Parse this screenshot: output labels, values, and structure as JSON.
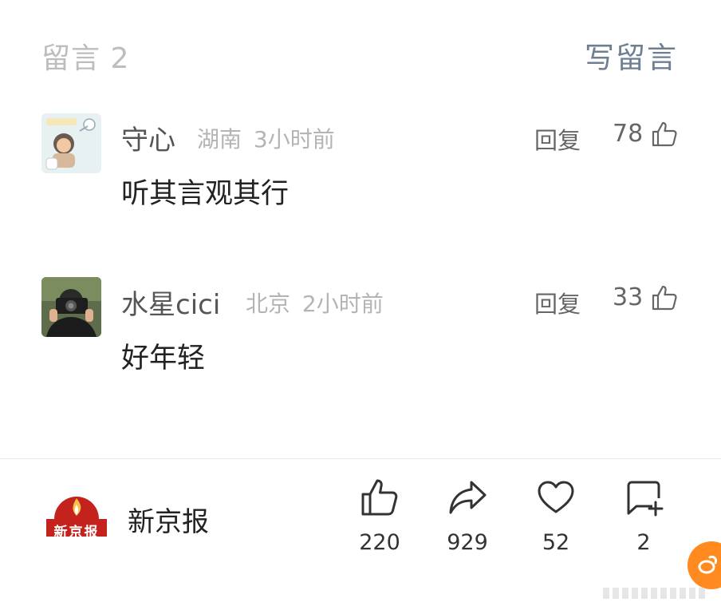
{
  "header": {
    "title": "留言 2",
    "write_label": "写留言"
  },
  "comments": [
    {
      "username": "守心",
      "location": "湖南",
      "time": "3小时前",
      "reply_label": "回复",
      "likes": "78",
      "text": "听其言观其行",
      "avatar_icon": "cartoon-avatar"
    },
    {
      "username": "水星cici",
      "location": "北京",
      "time": "2小时前",
      "reply_label": "回复",
      "likes": "33",
      "text": "好年轻",
      "avatar_icon": "photographer-avatar"
    }
  ],
  "footer": {
    "source_name": "新京报",
    "logo_text": "新京报",
    "actions": [
      {
        "icon": "thumbs-up-icon",
        "count": "220"
      },
      {
        "icon": "share-icon",
        "count": "929"
      },
      {
        "icon": "heart-icon",
        "count": "52"
      },
      {
        "icon": "add-comment-icon",
        "count": "2"
      }
    ]
  },
  "colors": {
    "accent": "#6e7f93",
    "logo_red": "#c4231d",
    "badge_orange": "#ff8a1f"
  }
}
